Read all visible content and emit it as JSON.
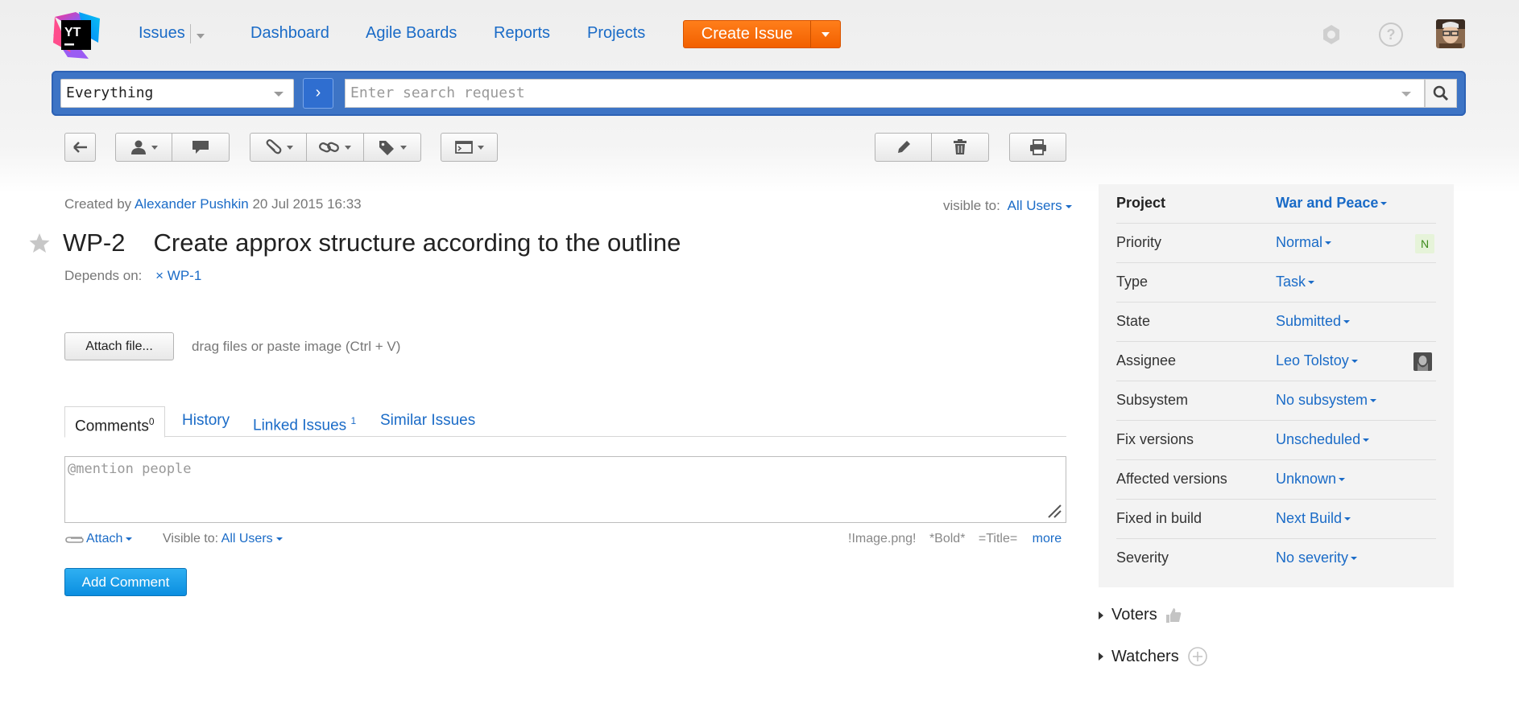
{
  "header": {
    "nav": {
      "issues": "Issues",
      "dashboard": "Dashboard",
      "agile_boards": "Agile Boards",
      "reports": "Reports",
      "projects": "Projects"
    },
    "create_issue": "Create Issue"
  },
  "search": {
    "context": "Everything",
    "placeholder": "Enter search request",
    "go_glyph": "›"
  },
  "issue": {
    "created_by_label": "Created by",
    "author": "Alexander Pushkin",
    "created_at": "20 Jul 2015 16:33",
    "visible_to_label": "visible to:",
    "visible_to": "All Users",
    "id": "WP-2",
    "summary": "Create approx structure according to the outline",
    "depends_on_label": "Depends on:",
    "depends_on": "× WP-1",
    "attach_button": "Attach file...",
    "attach_hint": "drag files or paste image (Ctrl + V)"
  },
  "tabs": [
    {
      "label": "Comments",
      "count": "0"
    },
    {
      "label": "History",
      "count": ""
    },
    {
      "label": "Linked Issues",
      "count": "1"
    },
    {
      "label": "Similar Issues",
      "count": ""
    }
  ],
  "comment": {
    "placeholder": "@mention people",
    "attach": "Attach",
    "visible_to_label": "Visible to:",
    "visible_to": "All Users",
    "hint_image": "!Image.png!",
    "hint_bold": "*Bold*",
    "hint_title": "=Title=",
    "more": "more",
    "submit": "Add Comment"
  },
  "fields": [
    {
      "label": "Project",
      "value": "War and Peace"
    },
    {
      "label": "Priority",
      "value": "Normal",
      "badge": "N"
    },
    {
      "label": "Type",
      "value": "Task"
    },
    {
      "label": "State",
      "value": "Submitted"
    },
    {
      "label": "Assignee",
      "value": "Leo Tolstoy"
    },
    {
      "label": "Subsystem",
      "value": "No subsystem"
    },
    {
      "label": "Fix versions",
      "value": "Unscheduled"
    },
    {
      "label": "Affected versions",
      "value": "Unknown"
    },
    {
      "label": "Fixed in build",
      "value": "Next Build"
    },
    {
      "label": "Severity",
      "value": "No severity"
    }
  ],
  "voters_label": "Voters",
  "watchers_label": "Watchers",
  "colors": {
    "accent": "#1a6bc7",
    "create_button": "#f26000",
    "search_bar": "#3d74c5",
    "add_comment": "#0b8ee0",
    "priority_badge_bg": "#e6f3d9",
    "priority_badge_fg": "#3d8b1c"
  },
  "icons": {
    "logo": "youtrack-logo",
    "settings": "gear-icon",
    "help": "help-icon",
    "search": "search-icon",
    "back": "back-arrow-icon",
    "assign": "user-icon",
    "comment": "speech-bubble-icon",
    "attach": "paperclip-icon",
    "link": "chain-link-icon",
    "tag": "tag-icon",
    "command": "command-window-icon",
    "edit": "pencil-icon",
    "delete": "trash-icon",
    "print": "printer-icon",
    "star": "star-icon",
    "vote": "thumbs-up-icon",
    "watch": "plus-circle-icon"
  }
}
